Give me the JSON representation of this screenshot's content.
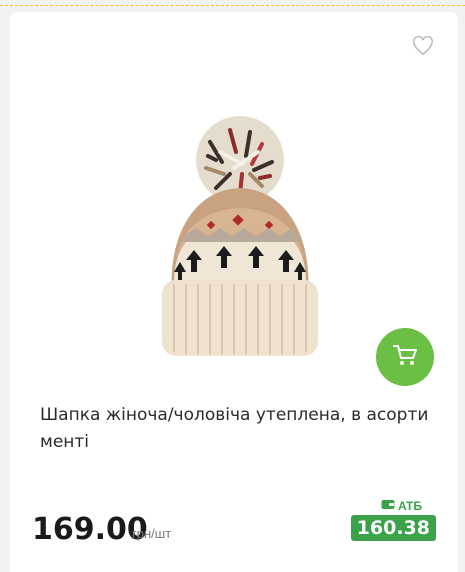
{
  "product": {
    "title": "Шапка жіноча/чоловіча утеплена, в асорти менті",
    "price": "169.00",
    "unit": "грн/шт",
    "club_label": "АТБ",
    "club_price": "160.38",
    "image_icon": "knit-beanie-with-pompom"
  },
  "icons": {
    "favorite": "heart-outline-icon",
    "cart": "shopping-cart-icon",
    "wallet": "wallet-icon"
  },
  "colors": {
    "accent_green": "#6bbf45",
    "club_green": "#3aa34a",
    "top_border": "#f3c623"
  }
}
